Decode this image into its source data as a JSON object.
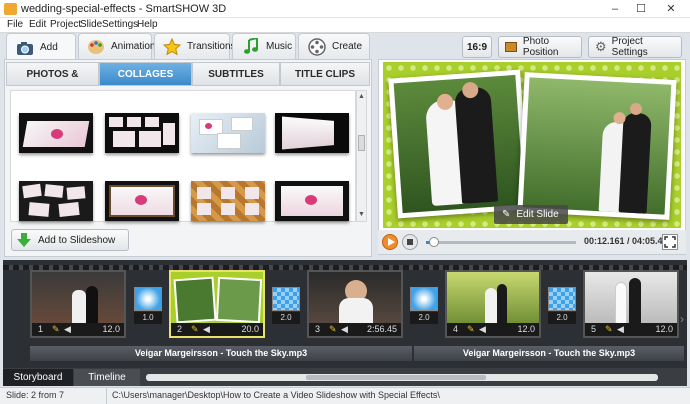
{
  "window": {
    "title": "wedding-special-effects - SmartSHOW 3D",
    "minimize": "–",
    "maximize": "☐",
    "close": "✕"
  },
  "menu": [
    "File",
    "Edit",
    "Project",
    "Slide",
    "Settings",
    "Help"
  ],
  "main_tabs": [
    {
      "label": "Add",
      "icon": "camera-icon"
    },
    {
      "label": "Animation",
      "icon": "palette-icon"
    },
    {
      "label": "Transitions",
      "icon": "star-icon"
    },
    {
      "label": "Music",
      "icon": "music-note-icon"
    },
    {
      "label": "Create",
      "icon": "film-reel-icon"
    }
  ],
  "toolbar": {
    "aspect": "16:9",
    "photo_position": "Photo Position",
    "project_settings": "Project Settings"
  },
  "sub_tabs": [
    "PHOTOS & VIDEOS",
    "COLLAGES",
    "SUBTITLES",
    "TITLE CLIPS"
  ],
  "add_to_slideshow": "Add to Slideshow",
  "preview": {
    "edit_slide": "Edit Slide",
    "time": "00:12.161 / 04:05.450",
    "progress": 0.05
  },
  "slides": [
    {
      "num": "1",
      "dur": "12.0"
    },
    {
      "num": "2",
      "dur": "20.0"
    },
    {
      "num": "3",
      "dur": "2:56.45"
    },
    {
      "num": "4",
      "dur": "12.0"
    },
    {
      "num": "5",
      "dur": "12.0"
    }
  ],
  "transitions": [
    "1.0",
    "2.0",
    "2.0",
    "2.0"
  ],
  "audio_tracks": [
    "Veigar Margeirsson - Touch the Sky.mp3",
    "Veigar Margeirsson - Touch the Sky.mp3"
  ],
  "bottom_tabs": [
    "Storyboard",
    "Timeline"
  ],
  "status": {
    "slide": "Slide: 2 from 7",
    "path": "C:\\Users\\manager\\Desktop\\How to Create a Video Slideshow with Special Effects\\"
  },
  "colors": {
    "accent": "#3b89cb",
    "stage_green": "#a9cf2c",
    "selected_slide": "#e8e26a"
  }
}
